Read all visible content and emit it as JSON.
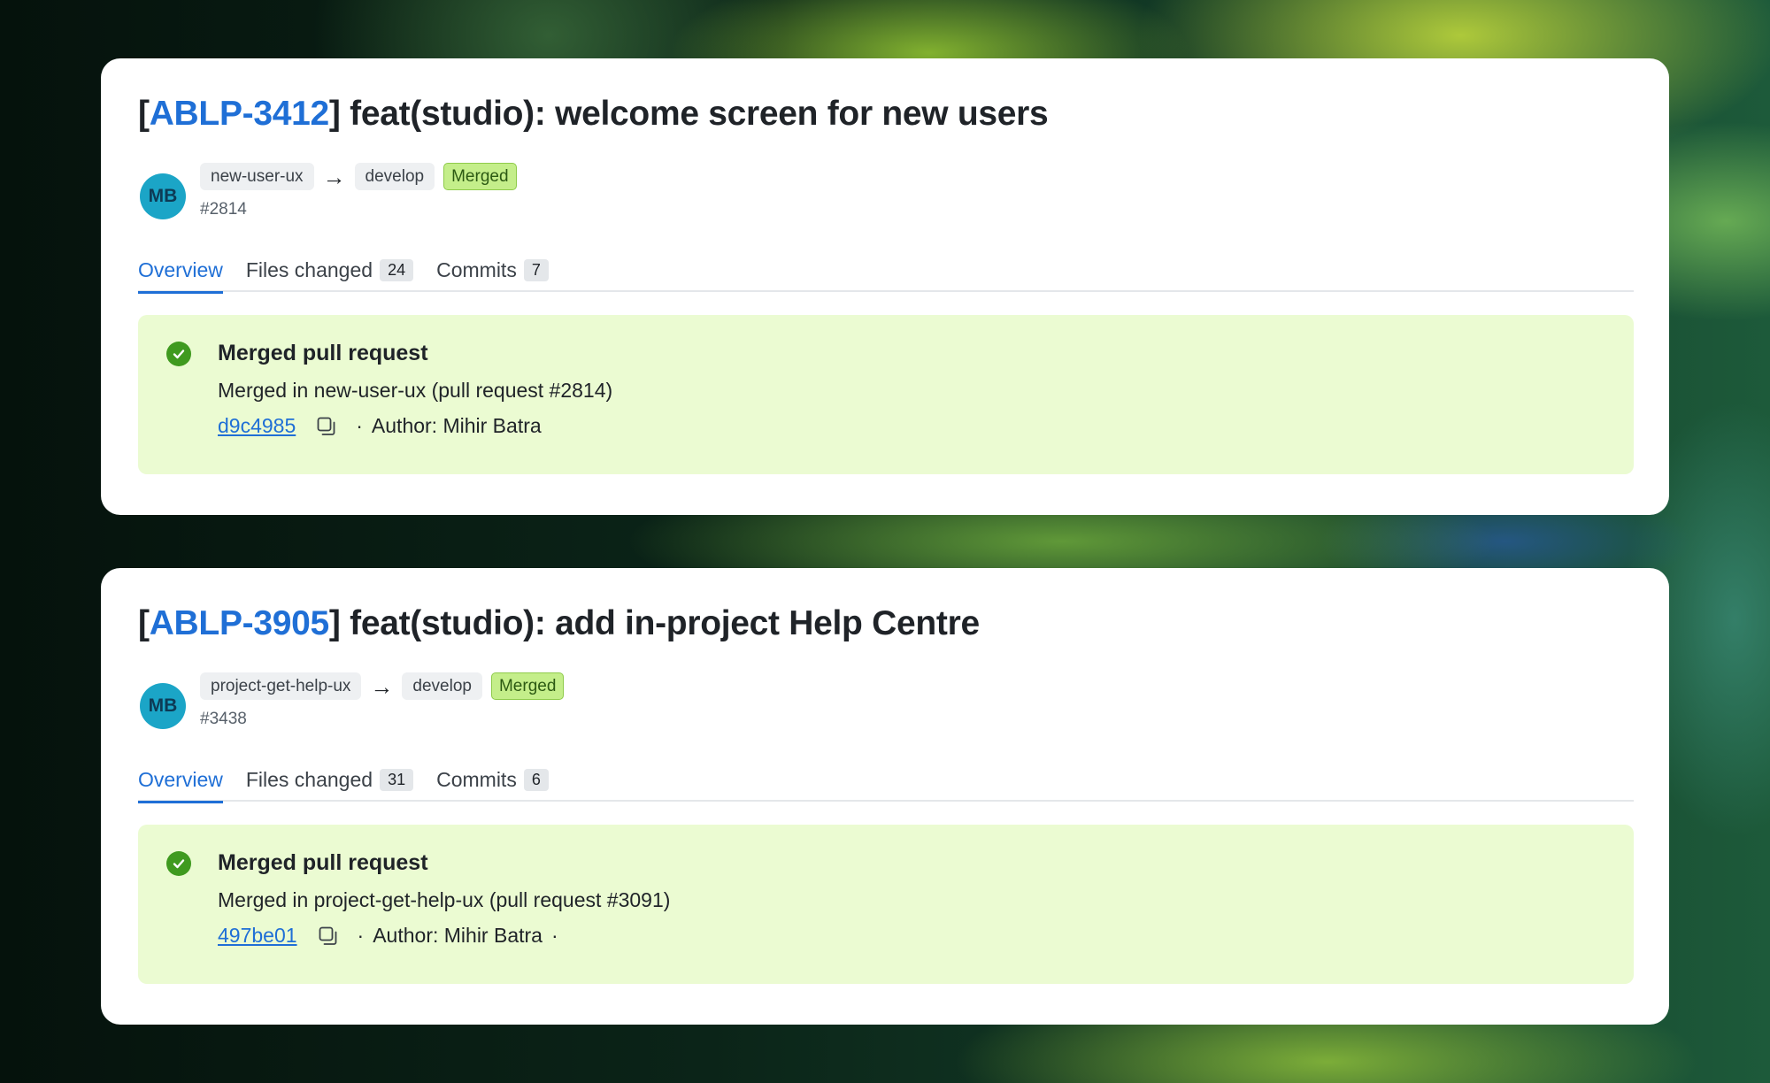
{
  "prs": [
    {
      "ticket": "ABLP-3412",
      "title": "feat(studio): welcome screen for new users",
      "avatar_initials": "MB",
      "source_branch": "new-user-ux",
      "target_branch": "develop",
      "state_badge": "Merged",
      "number": "#2814",
      "tabs": {
        "overview": "Overview",
        "files": "Files changed",
        "files_count": "24",
        "commits": "Commits",
        "commits_count": "7"
      },
      "status": {
        "title": "Merged pull request",
        "description": "Merged in new-user-ux (pull request #2814)",
        "commit_sha": "d9c4985",
        "author": "Author: Mihir Batra",
        "separator": "·",
        "trailing_separator": ""
      }
    },
    {
      "ticket": "ABLP-3905",
      "title": "feat(studio): add in-project Help Centre",
      "avatar_initials": "MB",
      "source_branch": "project-get-help-ux",
      "target_branch": "develop",
      "state_badge": "Merged",
      "number": "#3438",
      "tabs": {
        "overview": "Overview",
        "files": "Files changed",
        "files_count": "31",
        "commits": "Commits",
        "commits_count": "6"
      },
      "status": {
        "title": "Merged pull request",
        "description": "Merged in project-get-help-ux (pull request #3091)",
        "commit_sha": "497be01",
        "author": "Author: Mihir Batra",
        "separator": "·",
        "trailing_separator": "·"
      }
    }
  ],
  "icons": {
    "arrow": "arrow-right-icon",
    "check": "check-circle-icon",
    "copy": "copy-icon"
  },
  "colors": {
    "accent": "#1f6fd6",
    "merged_badge": "#c4ee8a",
    "status_bg": "#ebfbd2",
    "success": "#3f9a1f",
    "avatar": "#1ba5c7"
  }
}
